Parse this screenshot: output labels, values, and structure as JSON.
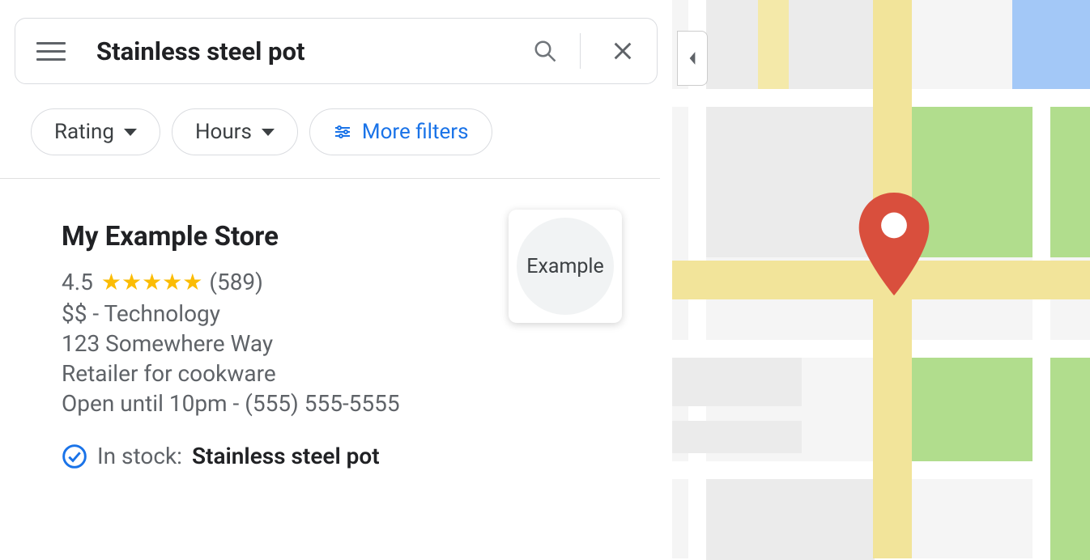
{
  "search": {
    "query": "Stainless steel pot"
  },
  "filters": {
    "rating_label": "Rating",
    "hours_label": "Hours",
    "more_label": "More filters"
  },
  "result": {
    "name": "My Example Store",
    "rating": "4.5",
    "stars": "★★★★★",
    "review_count": "(589)",
    "price_category": "$$ - Technology",
    "address": "123 Somewhere Way",
    "description": "Retailer for cookware",
    "hours_phone": "Open until 10pm - (555) 555-5555",
    "instock_label": "In stock:",
    "instock_product": "Stainless steel pot",
    "thumb_label": "Example"
  }
}
